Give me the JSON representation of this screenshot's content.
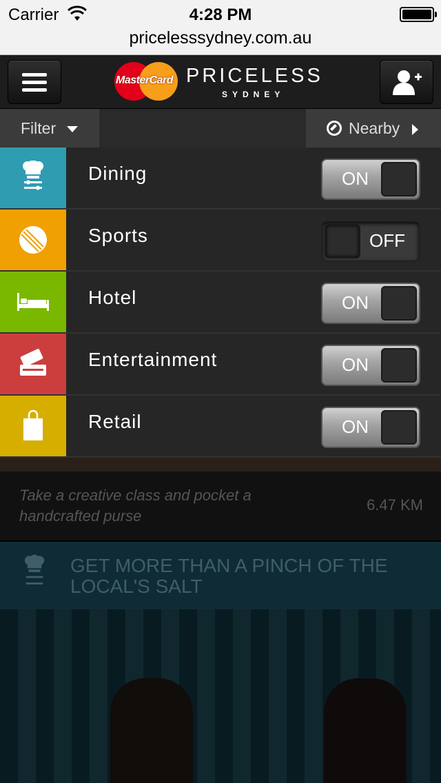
{
  "status_bar": {
    "carrier": "Carrier",
    "time": "4:28 PM"
  },
  "browser": {
    "url": "pricelesssydney.com.au"
  },
  "header": {
    "logo_text": "MasterCard",
    "brand": "PRICELESS",
    "city": "SYDNEY"
  },
  "filter_bar": {
    "filter_label": "Filter",
    "nearby_label": "Nearby"
  },
  "categories": [
    {
      "label": "Dining",
      "state": "ON",
      "color": "#2f9cb2",
      "icon": "chef-hat-icon"
    },
    {
      "label": "Sports",
      "state": "OFF",
      "color": "#f0a000",
      "icon": "cricket-ball-icon"
    },
    {
      "label": "Hotel",
      "state": "ON",
      "color": "#7ab800",
      "icon": "bed-icon"
    },
    {
      "label": "Entertainment",
      "state": "ON",
      "color": "#cc3e3e",
      "icon": "ticket-icon"
    },
    {
      "label": "Retail",
      "state": "ON",
      "color": "#d6ae00",
      "icon": "shopping-bag-icon"
    }
  ],
  "listing": {
    "title": "Take a creative class and pocket a handcrafted purse",
    "distance": "6.47 KM"
  },
  "promo": {
    "text": "GET MORE THAN A PINCH OF THE LOCAL'S SALT",
    "icon": "chef-hat-icon"
  }
}
